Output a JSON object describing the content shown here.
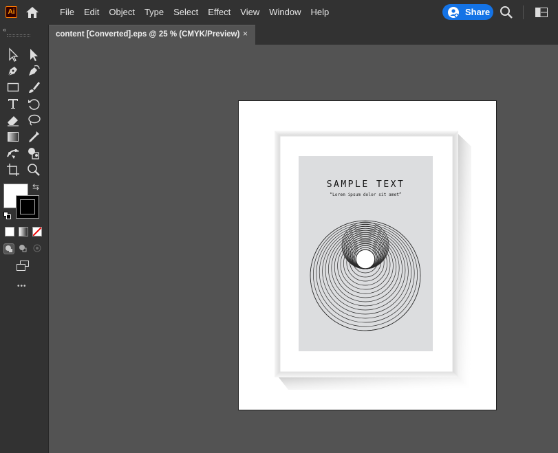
{
  "app": {
    "logo_text": "Ai",
    "menu": [
      "File",
      "Edit",
      "Object",
      "Type",
      "Select",
      "Effect",
      "View",
      "Window",
      "Help"
    ],
    "share_label": "Share"
  },
  "document": {
    "tab_title": "content [Converted].eps @ 25 % (CMYK/Preview)",
    "close_glyph": "×"
  },
  "toolbar": {
    "collapse_glyph": "«",
    "more_glyph": "•••",
    "swap_glyph": "⇆"
  },
  "artwork": {
    "heading": "SAMPLE TEXT",
    "subheading": "“Lorem ipsum dolor sit amet”"
  },
  "colors": {
    "accent": "#1473e6",
    "ui_dark": "#323232",
    "canvas": "#535353",
    "poster_bg": "#dcdddf"
  },
  "icons": [
    "home-icon",
    "search-icon",
    "workspace-icon",
    "selection-tool-icon",
    "direct-selection-tool-icon",
    "pen-tool-icon",
    "curvature-tool-icon",
    "rectangle-tool-icon",
    "paintbrush-tool-icon",
    "type-tool-icon",
    "rotate-tool-icon",
    "eraser-tool-icon",
    "lasso-tool-icon",
    "gradient-tool-icon",
    "eyedropper-tool-icon",
    "puppet-warp-tool-icon",
    "shape-builder-tool-icon",
    "artboard-tool-icon",
    "zoom-tool-icon"
  ]
}
